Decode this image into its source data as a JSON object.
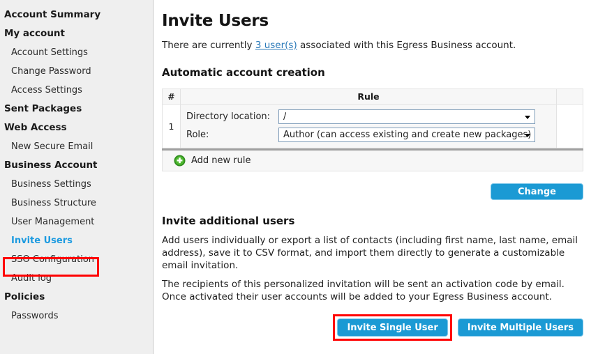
{
  "sidebar": {
    "items": [
      {
        "label": "Account Summary",
        "type": "header",
        "active": false
      },
      {
        "label": "My account",
        "type": "header",
        "active": false
      },
      {
        "label": "Account Settings",
        "type": "item",
        "active": false
      },
      {
        "label": "Change Password",
        "type": "item",
        "active": false
      },
      {
        "label": "Access Settings",
        "type": "item",
        "active": false
      },
      {
        "label": "Sent Packages",
        "type": "header",
        "active": false
      },
      {
        "label": "Web Access",
        "type": "header",
        "active": false
      },
      {
        "label": "New Secure Email",
        "type": "item",
        "active": false
      },
      {
        "label": "Business Account",
        "type": "header",
        "active": false
      },
      {
        "label": "Business Settings",
        "type": "item",
        "active": false
      },
      {
        "label": "Business Structure",
        "type": "item",
        "active": false
      },
      {
        "label": "User Management",
        "type": "item",
        "active": false
      },
      {
        "label": "Invite Users",
        "type": "item",
        "active": true
      },
      {
        "label": "SSO Configuration",
        "type": "item",
        "active": false
      },
      {
        "label": "Audit log",
        "type": "item",
        "active": false
      },
      {
        "label": "Policies",
        "type": "header",
        "active": false
      },
      {
        "label": "Passwords",
        "type": "item",
        "active": false
      }
    ]
  },
  "main": {
    "page_title": "Invite Users",
    "intro_prefix": "There are currently ",
    "intro_link": "3 user(s)",
    "intro_suffix": " associated with this Egress Business account.",
    "automatic_section_title": "Automatic account creation",
    "rules_table": {
      "columns": [
        "#",
        "Rule",
        ""
      ],
      "rows": [
        {
          "number": "1",
          "fields": [
            {
              "label": "Directory location:",
              "value": "/"
            },
            {
              "label": "Role:",
              "value": "Author (can access existing and create new packages)"
            }
          ]
        }
      ],
      "add_rule_label": "Add new rule",
      "add_rule_icon": "plus-circle-icon"
    },
    "change_button_label": "Change",
    "invite_section_title": "Invite additional users",
    "invite_paragraph_1": "Add users individually or export a list of contacts (including first name, last name, email address), save it to CSV format, and import them directly to generate a customizable email invitation.",
    "invite_paragraph_2": "The recipients of this personalized invitation will be sent an activation code by email. Once activated their user accounts will be added to your Egress Business account.",
    "invite_single_label": "Invite Single User",
    "invite_multiple_label": "Invite Multiple Users"
  },
  "colors": {
    "accent_blue": "#1b9ad4",
    "link_blue": "#2878b8",
    "active_nav_blue": "#1b9ae0",
    "highlight_red": "#ff0000",
    "sidebar_bg": "#efefef",
    "plus_green": "#3a9e26"
  }
}
